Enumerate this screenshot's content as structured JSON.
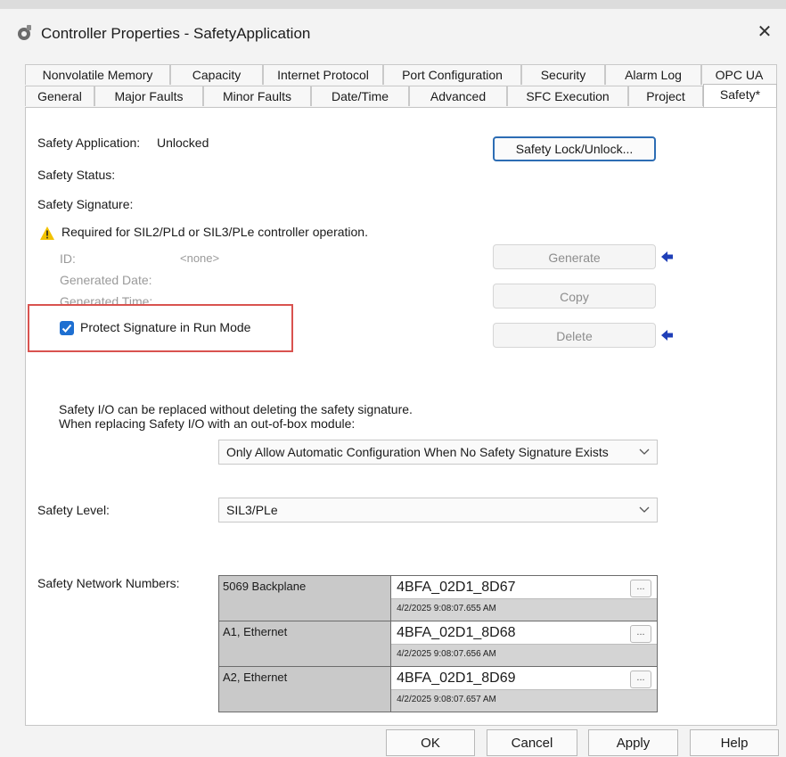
{
  "window": {
    "title": "Controller Properties - SafetyApplication",
    "close_label": "✕"
  },
  "tabs": {
    "row1": [
      "Nonvolatile Memory",
      "Capacity",
      "Internet Protocol",
      "Port Configuration",
      "Security",
      "Alarm Log",
      "OPC UA"
    ],
    "row2": [
      "General",
      "Major Faults",
      "Minor Faults",
      "Date/Time",
      "Advanced",
      "SFC Execution",
      "Project",
      "Safety*"
    ],
    "active": "Safety*"
  },
  "safety": {
    "application_label": "Safety Application:",
    "application_value": "Unlocked",
    "status_label": "Safety Status:",
    "signature_label": "Safety Signature:",
    "warning_text": "Required for SIL2/PLd or SIL3/PLe controller operation.",
    "id_label": "ID:",
    "id_value": "<none>",
    "generated_date_label": "Generated Date:",
    "generated_time_label": "Generated Time:",
    "protect_label": "Protect Signature in Run Mode",
    "protect_checked": true,
    "lock_button": "Safety Lock/Unlock...",
    "generate_button": "Generate",
    "copy_button": "Copy",
    "delete_button": "Delete"
  },
  "replace": {
    "line1": "Safety I/O can be replaced without deleting the safety signature.",
    "line2": "When replacing Safety I/O with an out-of-box module:",
    "selected": "Only Allow Automatic Configuration When No Safety Signature Exists"
  },
  "level": {
    "label": "Safety Level:",
    "selected": "SIL3/PLe"
  },
  "network": {
    "label": "Safety Network Numbers:",
    "rows": [
      {
        "name": "5069 Backplane",
        "number": "4BFA_02D1_8D67",
        "timestamp": "4/2/2025 9:08:07.655 AM"
      },
      {
        "name": "A1, Ethernet",
        "number": "4BFA_02D1_8D68",
        "timestamp": "4/2/2025 9:08:07.656 AM"
      },
      {
        "name": "A2, Ethernet",
        "number": "4BFA_02D1_8D69",
        "timestamp": "4/2/2025 9:08:07.657 AM"
      }
    ],
    "ellipsis": "..."
  },
  "footer": {
    "ok": "OK",
    "cancel": "Cancel",
    "apply": "Apply",
    "help": "Help"
  },
  "colors": {
    "accent": "#1e6fd1",
    "highlight_box": "#d9534f",
    "arrow": "#1f3fb8",
    "warning": "#f2c200"
  }
}
